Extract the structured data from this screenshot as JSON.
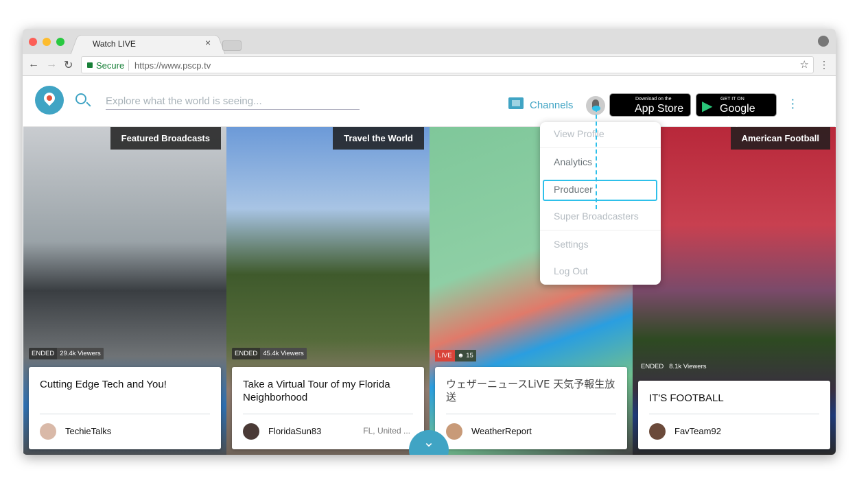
{
  "browser": {
    "tab_title": "Watch LIVE",
    "secure_label": "Secure",
    "url": "https://www.pscp.tv"
  },
  "header": {
    "search_placeholder": "Explore what the world is seeing...",
    "channels_label": "Channels",
    "app_store": {
      "small": "Download on the",
      "big": "App Store"
    },
    "google_play": {
      "small": "GET IT ON",
      "big": "Google Play"
    }
  },
  "menu": {
    "items": [
      "View Profile",
      "Analytics",
      "Producer",
      "Super Broadcasters",
      "Settings",
      "Log Out"
    ],
    "highlighted": "Producer"
  },
  "broadcasts": [
    {
      "category": "Featured Broadcasts",
      "status": "ENDED",
      "viewers": "29.4k Viewers",
      "title": "Cutting Edge Tech and You!",
      "user": "TechieTalks",
      "location": ""
    },
    {
      "category": "Travel the World",
      "status": "ENDED",
      "viewers": "45.4k Viewers",
      "title": "Take a Virtual Tour of my Florida Neighborhood",
      "user": "FloridaSun83",
      "location": "FL, United ..."
    },
    {
      "category": "",
      "status": "LIVE",
      "viewers": "15",
      "title": "ウェザーニュースLiVE 天気予報生放送",
      "user": "WeatherReport",
      "location": ""
    },
    {
      "category": "American Football",
      "status": "ENDED",
      "viewers": "8.1k Viewers",
      "title": "IT'S FOOTBALL",
      "user": "FavTeam92",
      "location": ""
    }
  ],
  "colors": {
    "accent": "#40a4c4",
    "live": "#d9443a",
    "highlight": "#2ec0ea"
  }
}
